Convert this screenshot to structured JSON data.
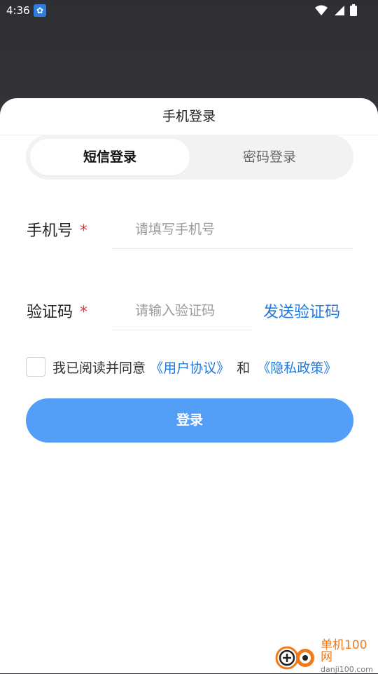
{
  "status_bar": {
    "time": "4:36"
  },
  "sheet": {
    "title": "手机登录"
  },
  "tabs": {
    "sms_label": "短信登录",
    "password_label": "密码登录"
  },
  "phone": {
    "label": "手机号",
    "required_mark": "*",
    "placeholder": "请填写手机号",
    "value": ""
  },
  "code": {
    "label": "验证码",
    "required_mark": "*",
    "placeholder": "请输入验证码",
    "value": "",
    "send_label": "发送验证码"
  },
  "agreement": {
    "checked": false,
    "prefix": "我已阅读并同意",
    "user_agreement": "《用户协议》",
    "joiner": "和",
    "privacy_policy": "《隐私政策》"
  },
  "login_button": {
    "label": "登录"
  },
  "watermark": {
    "cn": "单机100网",
    "en": "danji100.com"
  },
  "colors": {
    "accent": "#1f7ae0",
    "button": "#539ef6",
    "required": "#e53935"
  }
}
